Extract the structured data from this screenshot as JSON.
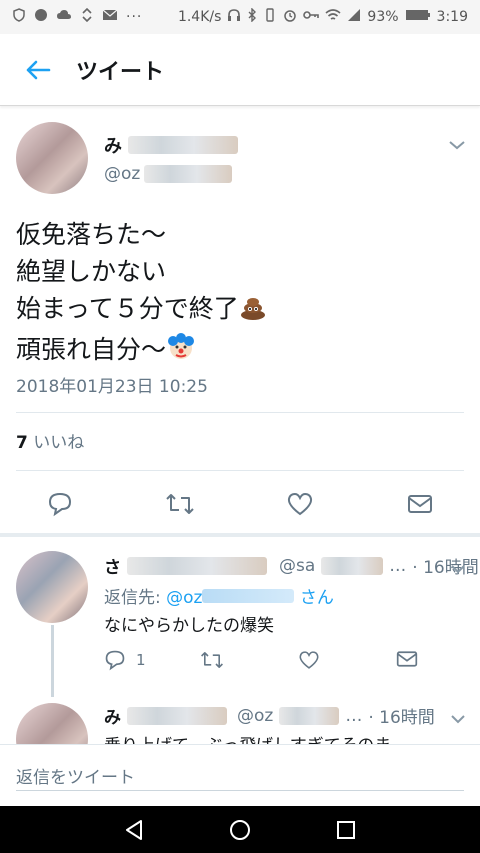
{
  "status_bar": {
    "network_speed": "1.4K/s",
    "battery": "93%",
    "time": "3:19"
  },
  "app_bar": {
    "title": "ツイート"
  },
  "tweet": {
    "author_name_visible": "み",
    "handle_visible": "@oz",
    "text_lines": [
      "仮免落ちた〜",
      "絶望しかない",
      "始まって５分で終了",
      "頑張れ自分〜"
    ],
    "timestamp": "2018年01月23日 10:25",
    "likes_count": "7",
    "likes_label": "いいね"
  },
  "replies": [
    {
      "name_visible": "さ",
      "handle_visible": "@sa",
      "time": "· 16時間",
      "reply_to_label": "返信先:",
      "reply_to_handle": "@oz",
      "reply_to_suffix": "さん",
      "text": "なにやらかしたの爆笑",
      "reply_count": "1"
    },
    {
      "name_visible": "み",
      "handle_visible": "@oz",
      "time": "· 16時間",
      "text": "乗り上げて、ぶっ飛ばしすぎてそのま"
    }
  ],
  "compose": {
    "placeholder": "返信をツイート"
  },
  "colors": {
    "accent": "#1da1f2",
    "secondary_text": "#657786"
  }
}
